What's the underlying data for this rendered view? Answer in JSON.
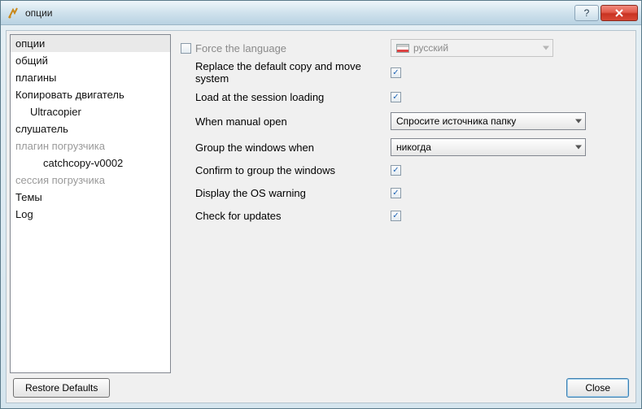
{
  "window": {
    "title": "опции"
  },
  "sidebar": {
    "items": [
      {
        "label": "опции",
        "selected": true
      },
      {
        "label": "общий"
      },
      {
        "label": "плагины"
      },
      {
        "label": "Копировать двигатель"
      },
      {
        "label": "Ultracopier",
        "indent": 1
      },
      {
        "label": "слушатель"
      },
      {
        "label": "плагин погрузчика",
        "disabled": true
      },
      {
        "label": "catchcopy-v0002",
        "indent": 2
      },
      {
        "label": "сессия погрузчика",
        "disabled": true
      },
      {
        "label": "Темы"
      },
      {
        "label": "Log"
      }
    ]
  },
  "settings": {
    "force_language": {
      "label": "Force the language",
      "checked": false,
      "value": "русский",
      "select_disabled": true
    },
    "replace_copy": {
      "label": "Replace the default copy and move system",
      "checked": true
    },
    "load_session": {
      "label": "Load at the session loading",
      "checked": true
    },
    "manual_open": {
      "label": "When manual open",
      "value": "Спросите источника папку"
    },
    "group_windows_when": {
      "label": "Group the windows when",
      "value": "никогда"
    },
    "confirm_group": {
      "label": "Confirm to group the windows",
      "checked": true
    },
    "os_warning": {
      "label": "Display the OS warning",
      "checked": true
    },
    "check_updates": {
      "label": "Check for updates",
      "checked": true
    }
  },
  "buttons": {
    "restore": "Restore Defaults",
    "close": "Close"
  }
}
